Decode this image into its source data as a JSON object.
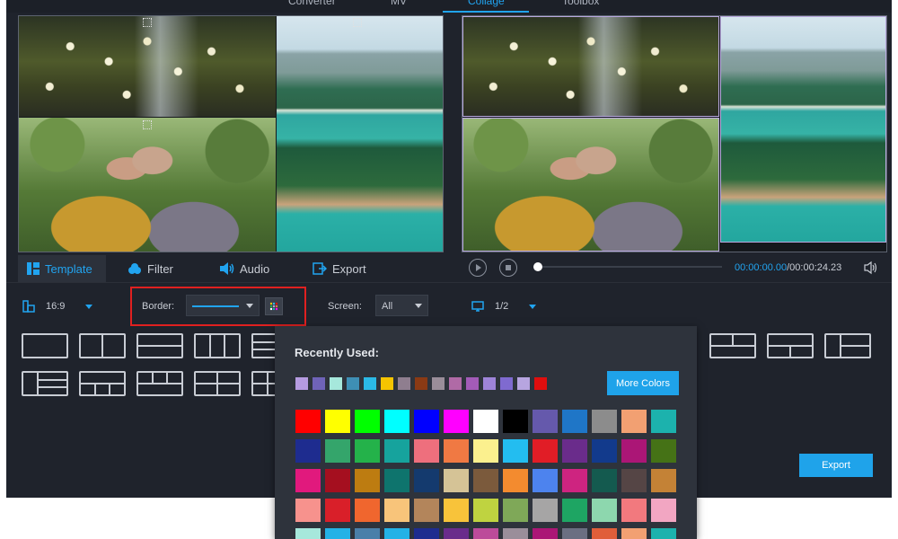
{
  "nav": {
    "tabs": [
      "Converter",
      "MV",
      "Collage",
      "Toolbox"
    ],
    "active": "Collage"
  },
  "tabs": {
    "template": "Template",
    "filter": "Filter",
    "audio": "Audio",
    "export": "Export"
  },
  "player": {
    "current_time": "00:00:00.00",
    "total_time": "/00:00:24.23",
    "progress": 0
  },
  "toolbar": {
    "aspect": "16:9",
    "border_label": "Border:",
    "screen_label": "Screen:",
    "screen_value": "All",
    "page": "1/2"
  },
  "color_picker": {
    "title": "Recently Used:",
    "more_colors": "More Colors",
    "recent": [
      "#b59be0",
      "#6f63b8",
      "#a6e8dc",
      "#3e8fb5",
      "#2bb9e6",
      "#f5c400",
      "#8f7e8f",
      "#8a3a14",
      "#9a8e9a",
      "#b06aa6",
      "#a35bb8",
      "#9e84d8",
      "#7f6ad0",
      "#b7a5e0",
      "#e00e0e"
    ],
    "palette": [
      [
        "#ff0000",
        "#ffff00",
        "#00ff00",
        "#00ffff",
        "#0000ff",
        "#ff00ff",
        "#ffffff",
        "#000000",
        "#6559ac",
        "#1f76c7",
        "#8c8c8c",
        "#f2a072",
        "#1cb2ad"
      ],
      [
        "#1e2c8f",
        "#34a56b",
        "#24b24a",
        "#16a39d",
        "#ee6f7d",
        "#f07943",
        "#fbf08e",
        "#23bdf0",
        "#e11d26",
        "#6a2c8b",
        "#123a8c",
        "#ab1676",
        "#457216"
      ],
      [
        "#e1197d",
        "#a50f1f",
        "#bd7c11",
        "#0e746d",
        "#143a6e",
        "#d5c396",
        "#7b5a3c",
        "#f38b2f",
        "#4d83ee",
        "#ce2480",
        "#145a4f",
        "#554545",
        "#c48236"
      ],
      [
        "#f7928d",
        "#d91f29",
        "#f0662e",
        "#f8c47a",
        "#b3855b",
        "#f8c33a",
        "#bfd340",
        "#7fa858",
        "#a6a5a5",
        "#1ea563",
        "#8dd7ae",
        "#f2797e",
        "#f2a6c2"
      ],
      [
        "#a6e8dc",
        "#23b2e6",
        "#4a7fa9",
        "#23b2e6",
        "#1e2c8f",
        "#6a2c8b",
        "#bc4b9a",
        "#9a8e9a",
        "#ab1676",
        "#6b6f82",
        "#e05e3a",
        "#f2a072",
        "#1cb2ad"
      ]
    ]
  },
  "export_label": "Export"
}
